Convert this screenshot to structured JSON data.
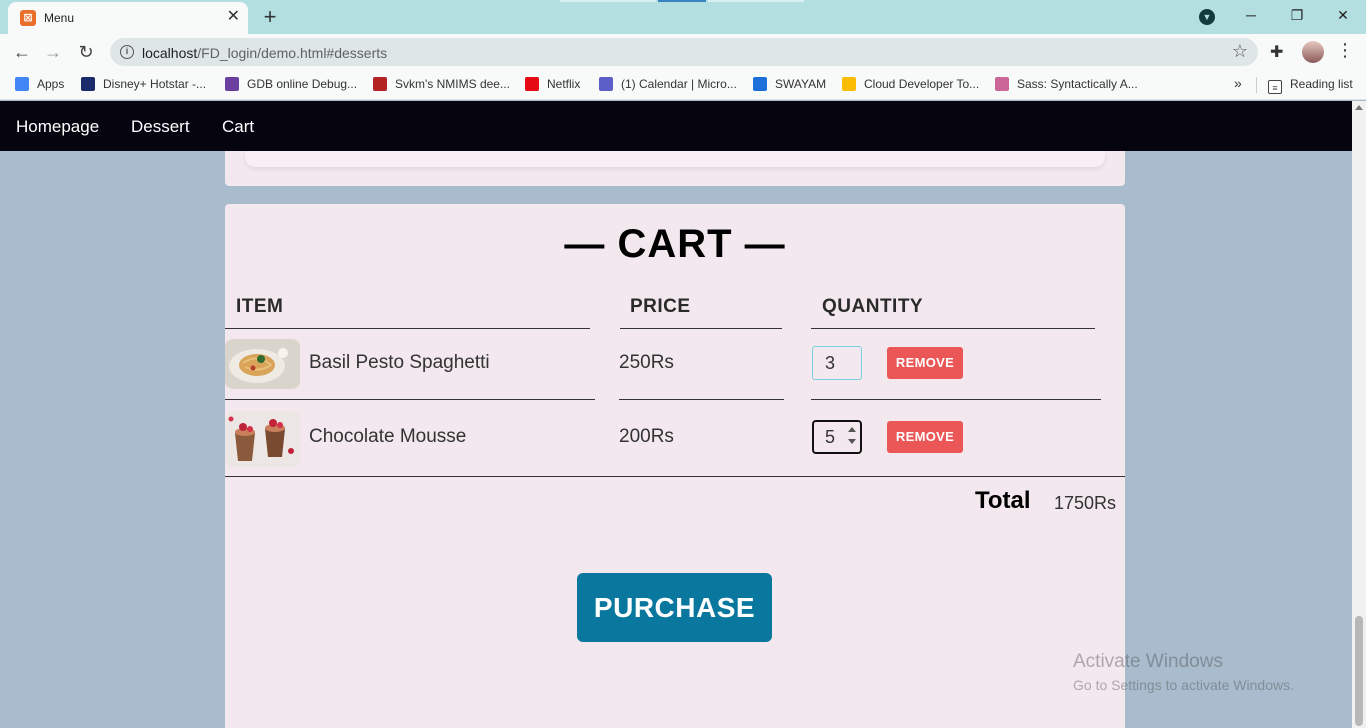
{
  "browser": {
    "tab_title": "Menu",
    "tab_close": "✕",
    "new_tab": "+",
    "url_host": "localhost",
    "url_path": "/FD_login/demo.html#desserts",
    "window_minimize": "─",
    "window_restore": "❐",
    "window_close": "✕",
    "bookmarks": [
      {
        "label": "Apps",
        "icon": "apps-grid-icon",
        "color": "#4285f4"
      },
      {
        "label": "Disney+ Hotstar -...",
        "icon": "hotstar-icon",
        "color": "#1a2b6b"
      },
      {
        "label": "GDB online Debug...",
        "icon": "gdb-icon",
        "color": "#6b3fa0"
      },
      {
        "label": "Svkm's NMIMS dee...",
        "icon": "nmims-icon",
        "color": "#b22222"
      },
      {
        "label": "Netflix",
        "icon": "netflix-icon",
        "color": "#e50914"
      },
      {
        "label": "(1) Calendar | Micro...",
        "icon": "teams-icon",
        "color": "#5b5fc7"
      },
      {
        "label": "SWAYAM",
        "icon": "swayam-icon",
        "color": "#1e6fd9"
      },
      {
        "label": "Cloud Developer To...",
        "icon": "google-cloud-icon",
        "color": "#fbbc04"
      },
      {
        "label": "Sass: Syntactically A...",
        "icon": "sass-icon",
        "color": "#cc6699"
      }
    ],
    "bookmarks_more": "»",
    "reading_list": "Reading list"
  },
  "nav": {
    "links": [
      "Homepage",
      "Dessert",
      "Cart"
    ]
  },
  "cart": {
    "title": "— CART —",
    "headers": {
      "item": "ITEM",
      "price": "PRICE",
      "quantity": "QUANTITY"
    },
    "rows": [
      {
        "name": "Basil Pesto Spaghetti",
        "price": "250Rs",
        "quantity": "3",
        "remove": "REMOVE"
      },
      {
        "name": "Chocolate Mousse",
        "price": "200Rs",
        "quantity": "5",
        "remove": "REMOVE"
      }
    ],
    "total_label": "Total",
    "total_value": "1750Rs",
    "purchase": "PURCHASE"
  },
  "watermark": {
    "line1": "Activate Windows",
    "line2": "Go to Settings to activate Windows."
  },
  "colors": {
    "page_bg": "#a9bccd",
    "nav_bg": "#06040f",
    "card_bg": "#f2e8ee",
    "remove_btn": "#eb5757",
    "purchase_btn": "#0a789e"
  }
}
